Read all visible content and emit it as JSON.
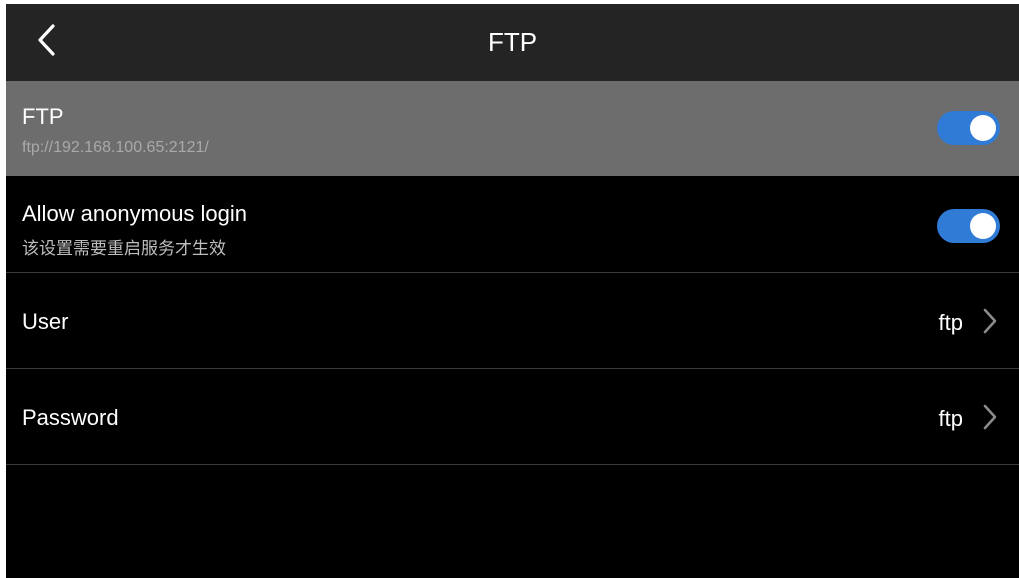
{
  "header": {
    "title": "FTP",
    "back_icon": "chevron-left-icon"
  },
  "colors": {
    "toggle_on": "#2f7bd6",
    "highlight_row": "#6d6d6d",
    "header_bg": "#242424",
    "background": "#000000"
  },
  "rows": {
    "ftp": {
      "title": "FTP",
      "subtitle": "ftp://192.168.100.65:2121/",
      "enabled": true
    },
    "anonymous": {
      "title": "Allow anonymous login",
      "subtitle": "该设置需要重启服务才生效",
      "enabled": true
    },
    "user": {
      "label": "User",
      "value": "ftp",
      "icon": "chevron-right-icon"
    },
    "password": {
      "label": "Password",
      "value": "ftp",
      "icon": "chevron-right-icon"
    }
  }
}
